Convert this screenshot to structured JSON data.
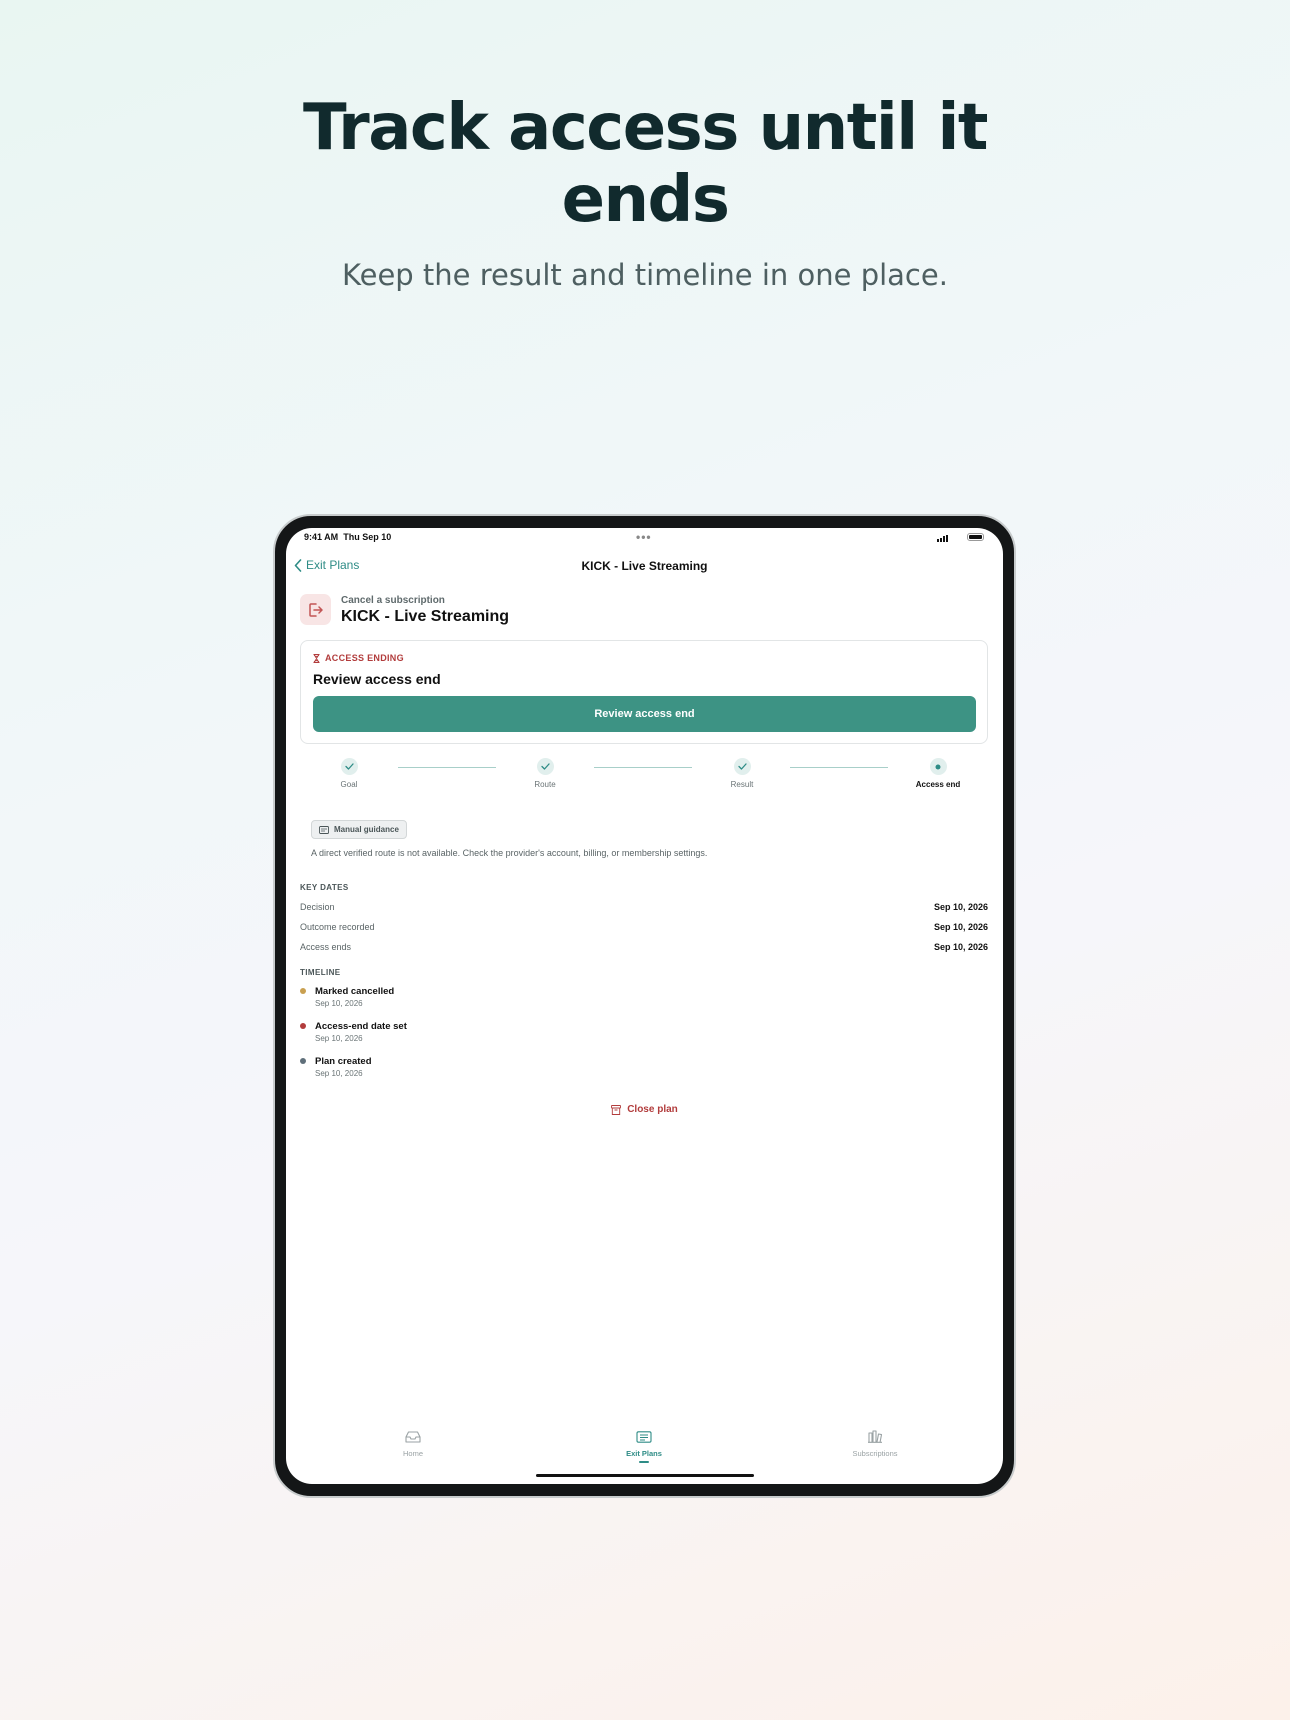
{
  "marketing": {
    "headline": "Track access until it ends",
    "subhead": "Keep the result and timeline in one place."
  },
  "status_bar": {
    "time": "9:41 AM",
    "date": "Thu Sep 10"
  },
  "nav": {
    "back_label": "Exit Plans",
    "title": "KICK - Live Streaming"
  },
  "plan": {
    "kicker": "Cancel a subscription",
    "title": "KICK - Live Streaming",
    "icon": "exit-door-icon"
  },
  "status_card": {
    "badge": "ACCESS ENDING",
    "title": "Review access end",
    "button_label": "Review access end"
  },
  "steps": [
    {
      "label": "Goal",
      "state": "done"
    },
    {
      "label": "Route",
      "state": "done"
    },
    {
      "label": "Result",
      "state": "done"
    },
    {
      "label": "Access end",
      "state": "current"
    }
  ],
  "guidance": {
    "chip": "Manual guidance",
    "text": "A direct verified route is not available. Check the provider's account, billing, or membership settings."
  },
  "key_dates": {
    "heading": "KEY DATES",
    "rows": [
      {
        "label": "Decision",
        "value": "Sep 10, 2026"
      },
      {
        "label": "Outcome recorded",
        "value": "Sep 10, 2026"
      },
      {
        "label": "Access ends",
        "value": "Sep 10, 2026"
      }
    ]
  },
  "timeline": {
    "heading": "TIMELINE",
    "items": [
      {
        "title": "Marked cancelled",
        "date": "Sep 10, 2026",
        "color": "#c9a050"
      },
      {
        "title": "Access-end date set",
        "date": "Sep 10, 2026",
        "color": "#b23c3c"
      },
      {
        "title": "Plan created",
        "date": "Sep 10, 2026",
        "color": "#5f6f7a"
      }
    ]
  },
  "close_plan_label": "Close plan",
  "tabs": [
    {
      "label": "Home",
      "icon": "home-tray-icon",
      "active": false
    },
    {
      "label": "Exit Plans",
      "icon": "list-icon",
      "active": true
    },
    {
      "label": "Subscriptions",
      "icon": "stack-icon",
      "active": false
    }
  ],
  "colors": {
    "accent": "#3d9384",
    "danger": "#b23c3c",
    "headline": "#112a2d"
  }
}
